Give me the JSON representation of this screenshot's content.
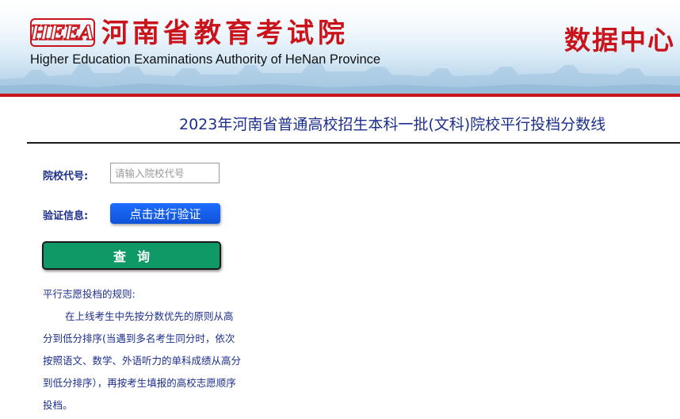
{
  "header": {
    "logo_text": "HEEA",
    "org_name_cn": "河南省教育考试院",
    "org_name_en": "Higher Education Examinations Authority of HeNan Province",
    "data_center": "数据中心",
    "accent_color": "#c8141a"
  },
  "page": {
    "title": "2023年河南省普通高校招生本科一批(文科)院校平行投档分数线"
  },
  "form": {
    "school_code_label": "院校代号:",
    "school_code_value": "",
    "school_code_placeholder": "请输入院校代号",
    "verify_label": "验证信息:",
    "verify_button": "点击进行验证",
    "query_button": "查询"
  },
  "rules": {
    "title": "平行志愿投档的规则:",
    "body": "在上线考生中先按分数优先的原则从高分到低分排序(当遇到多名考生同分时，依次按照语文、数学、外语听力的单科成绩从高分到低分排序），再按考生填报的高校志愿顺序投档。"
  }
}
